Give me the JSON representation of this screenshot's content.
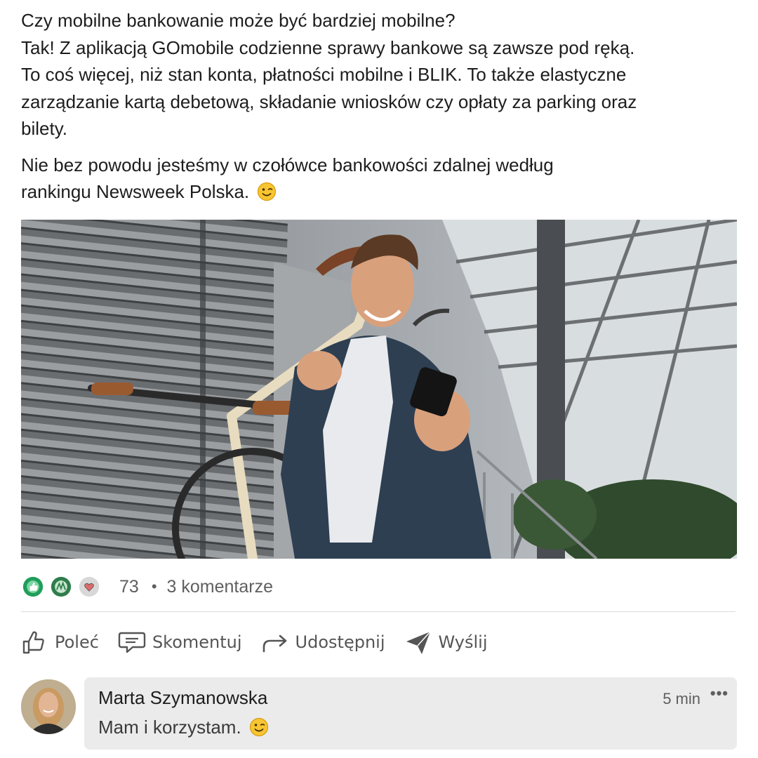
{
  "post": {
    "paragraph1": [
      "Czy mobilne bankowanie może być bardziej mobilne?",
      "Tak! Z aplikacją GOmobile codzienne sprawy bankowe są zawsze pod ręką.",
      "To coś więcej, niż stan konta, płatności mobilne i BLIK. To także elastyczne",
      "zarządzanie kartą debetową, składanie wniosków czy opłaty za parking oraz",
      "bilety."
    ],
    "paragraph2": [
      "Nie bez powodu jesteśmy w czołówce bankowości zdalnej według",
      "rankingu Newsweek Polska."
    ],
    "emoji": "winking-face"
  },
  "social": {
    "reaction_icons": [
      "like-icon",
      "celebrate-icon",
      "love-icon"
    ],
    "reaction_count": "73",
    "separator": "•",
    "comments_label": "3 komentarze"
  },
  "actions": [
    {
      "label": "Poleć",
      "icon": "thumbs-up-icon"
    },
    {
      "label": "Skomentuj",
      "icon": "comment-icon"
    },
    {
      "label": "Udostępnij",
      "icon": "share-arrow-icon"
    },
    {
      "label": "Wyślij",
      "icon": "send-icon"
    }
  ],
  "comment": {
    "author": "Marta Szymanowska",
    "time": "5 min",
    "more": "•••",
    "text": "Mam i korzystam.",
    "emoji": "winking-face"
  },
  "colors": {
    "like_green": "#1f9e5a",
    "celebrate_green": "#2e7d4b",
    "comment_bg": "#ebebeb",
    "muted_text": "#5f5f5f"
  }
}
